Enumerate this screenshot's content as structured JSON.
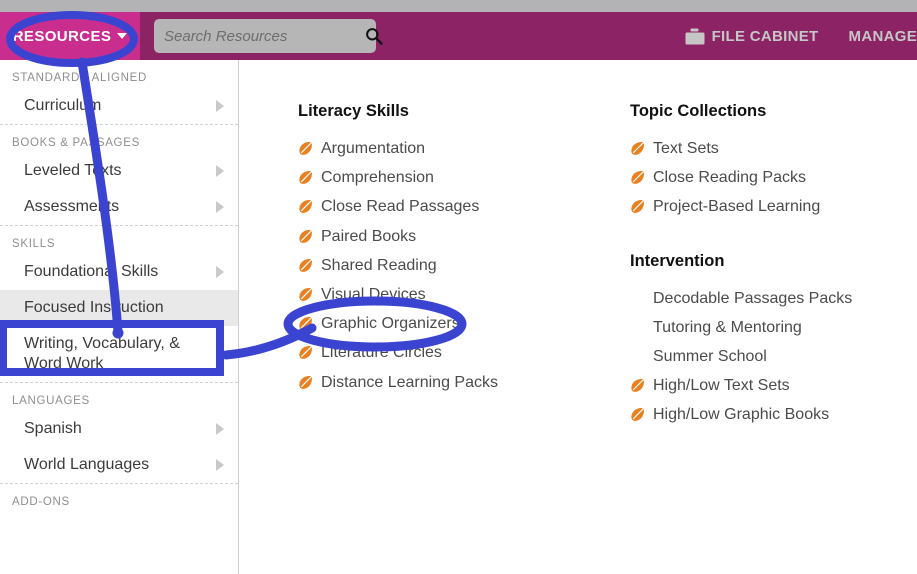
{
  "header": {
    "resources_tab": "RESOURCES",
    "resources_tab_icon": "chevron-down-icon",
    "search": {
      "placeholder": "Search Resources",
      "value": "",
      "icon": "search-icon"
    },
    "file_cabinet": "FILE CABINET",
    "file_cabinet_icon": "file-cabinet-icon",
    "manage": "MANAGE",
    "colors": {
      "bar": "#8c2364",
      "active_tab": "#c92d8e",
      "link_text": "#c6c6c6",
      "search_bg": "#b6b6b6",
      "chrome_strip": "#b3b3b5"
    }
  },
  "sidebar": {
    "groups": [
      {
        "heading": "STANDARDS ALIGNED",
        "items": [
          {
            "label": "Curriculum",
            "chevron": true,
            "active": false
          }
        ]
      },
      {
        "heading": "BOOKS & PASSAGES",
        "items": [
          {
            "label": "Leveled Texts",
            "chevron": true,
            "active": false
          },
          {
            "label": "Assessments",
            "chevron": true,
            "active": false
          }
        ]
      },
      {
        "heading": "SKILLS",
        "items": [
          {
            "label": "Foundational Skills",
            "chevron": true,
            "active": false
          },
          {
            "label": "Focused Instruction",
            "chevron": false,
            "active": true
          },
          {
            "label": "Writing, Vocabulary, & Word Work",
            "chevron": true,
            "active": false
          }
        ]
      },
      {
        "heading": "LANGUAGES",
        "items": [
          {
            "label": "Spanish",
            "chevron": true,
            "active": false
          },
          {
            "label": "World Languages",
            "chevron": true,
            "active": false
          }
        ]
      },
      {
        "heading": "ADD-ONS",
        "items": []
      }
    ]
  },
  "main": {
    "columns": [
      {
        "sections": [
          {
            "title": "Literacy Skills",
            "items": [
              {
                "label": "Argumentation",
                "icon": true
              },
              {
                "label": "Comprehension",
                "icon": true
              },
              {
                "label": "Close Read Passages",
                "icon": true
              },
              {
                "label": "Paired Books",
                "icon": true
              },
              {
                "label": "Shared Reading",
                "icon": true
              },
              {
                "label": "Visual Devices",
                "icon": true
              },
              {
                "label": "Graphic Organizers",
                "icon": true
              },
              {
                "label": "Literature Circles",
                "icon": true
              },
              {
                "label": "Distance Learning Packs",
                "icon": true
              }
            ]
          }
        ]
      },
      {
        "sections": [
          {
            "title": "Topic Collections",
            "items": [
              {
                "label": "Text Sets",
                "icon": true
              },
              {
                "label": "Close Reading Packs",
                "icon": true
              },
              {
                "label": "Project-Based Learning",
                "icon": true
              }
            ]
          },
          {
            "title": "Intervention",
            "items": [
              {
                "label": "Decodable Passages Packs",
                "icon": false
              },
              {
                "label": "Tutoring & Mentoring",
                "icon": false
              },
              {
                "label": "Summer School",
                "icon": false
              },
              {
                "label": "High/Low Text Sets",
                "icon": true
              },
              {
                "label": "High/Low Graphic Books",
                "icon": true
              }
            ]
          }
        ]
      }
    ],
    "leaf_icon_color": "#e8801f"
  },
  "annotations": {
    "color": "#3b44d0",
    "shapes": [
      {
        "type": "ellipse",
        "target": "RESOURCES"
      },
      {
        "type": "rectangle",
        "target": "Focused Instruction"
      },
      {
        "type": "ellipse",
        "target": "Graphic Organizers"
      },
      {
        "type": "arrow",
        "from": "RESOURCES",
        "to": "Focused Instruction"
      },
      {
        "type": "arrow",
        "from": "Focused Instruction",
        "to": "Graphic Organizers"
      }
    ]
  }
}
